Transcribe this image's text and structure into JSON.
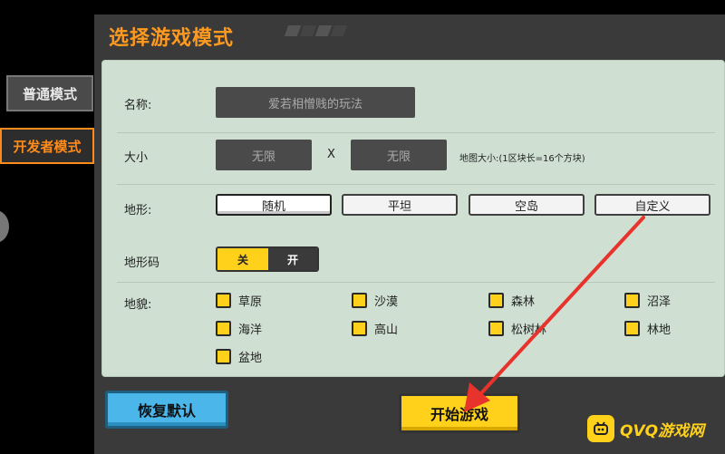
{
  "sidebar": {
    "normal_mode": "普通模式",
    "dev_mode": "开发者模式"
  },
  "header": {
    "title": "选择游戏模式"
  },
  "form": {
    "name": {
      "label": "名称:",
      "value": "爱若相憎贱的玩法"
    },
    "size": {
      "label": "大小",
      "width": "无限",
      "separator": "X",
      "height": "无限",
      "note": "地图大小:(1区块长=16个方块)"
    },
    "terrain": {
      "label": "地形:",
      "options": [
        "随机",
        "平坦",
        "空岛",
        "自定义"
      ],
      "selected": "随机"
    },
    "terrain_code": {
      "label": "地形码",
      "off": "关",
      "on": "开",
      "state": "关"
    },
    "biomes": {
      "label": "地貌:",
      "items": [
        "草原",
        "沙漠",
        "森林",
        "沼泽",
        "海洋",
        "高山",
        "松树林",
        "林地",
        "盆地"
      ]
    }
  },
  "footer": {
    "reset_label": "恢复默认",
    "start_label": "开始游戏"
  },
  "watermark": {
    "text": "QVQ游戏网"
  },
  "colors": {
    "accent": "#ff9a1f",
    "panel_bg": "#cfe0d3",
    "checkbox": "#ffd11a",
    "start_button": "#ffd11a",
    "reset_button": "#4bb6ea",
    "arrow": "#e8322c"
  }
}
